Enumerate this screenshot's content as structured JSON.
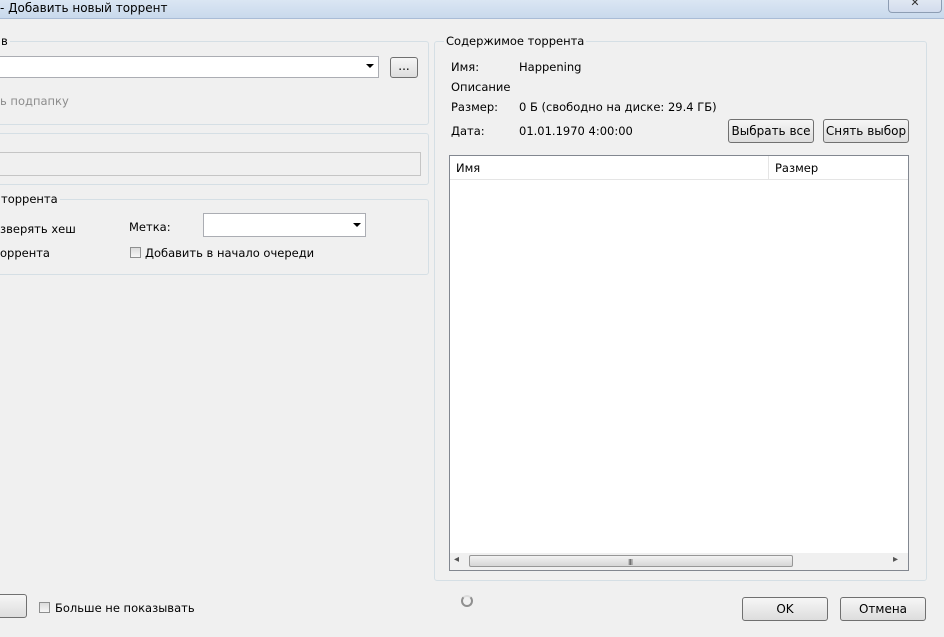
{
  "window": {
    "title": "- Добавить новый торрент",
    "close_icon": "✕"
  },
  "left": {
    "save_group_label": "в",
    "browse_label": "...",
    "subfolder_label": "ь подпапку",
    "torrent_group_label": "торрента",
    "skip_hash_label": "зверять хеш",
    "start_torrent_label": "оррента",
    "tag_label": "Метка:",
    "add_to_top_label": "Добавить в начало очереди"
  },
  "content": {
    "group_label": "Содержимое торрента",
    "name_label": "Имя:",
    "name_value": "Happening",
    "description_label": "Описание",
    "size_label": "Размер:",
    "size_value": "0 Б (свободно на диске: 29.4 ГБ)",
    "date_label": "Дата:",
    "date_value": "01.01.1970 4:00:00",
    "select_all_label": "Выбрать все",
    "deselect_label": "Снять выбор",
    "columns": [
      "Имя",
      "Размер"
    ],
    "scroll_left_icon": "◂",
    "scroll_right_icon": "▸",
    "scroll_grip": "III"
  },
  "footer": {
    "dont_show_label": "Больше не показывать",
    "ok_label": "OK",
    "cancel_label": "Отмена"
  }
}
